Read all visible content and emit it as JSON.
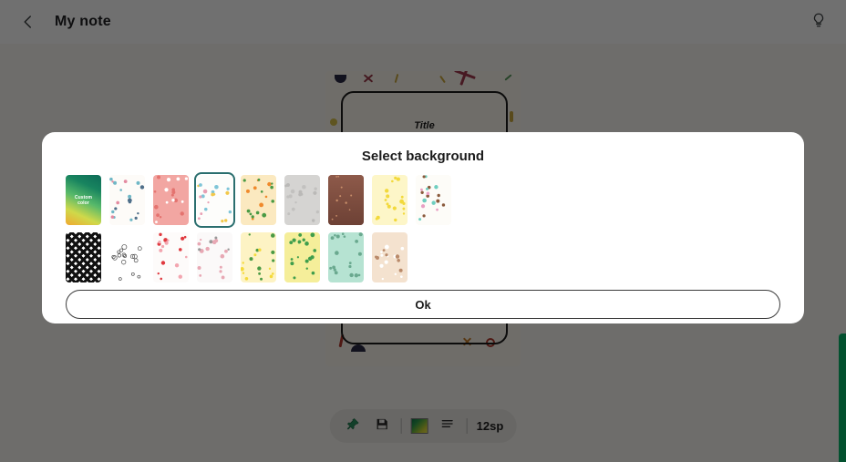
{
  "header": {
    "title": "My note",
    "back_icon": "back-chevron-icon",
    "hint_icon": "lightbulb-icon"
  },
  "note_preview": {
    "title_placeholder": "Title"
  },
  "dialog": {
    "title": "Select background",
    "ok_label": "Ok",
    "selected_index": 3,
    "thumbnails": [
      {
        "name": "custom-color",
        "label": "Custom\ncolor",
        "kind": "gradient",
        "colors": [
          "#f0a830",
          "#cfd94a",
          "#57b96a",
          "#18845f",
          "#0d6b57"
        ]
      },
      {
        "name": "sea-creatures",
        "label": "",
        "kind": "pattern",
        "colors": [
          "#fdfbf8",
          "#4f6f8a",
          "#e38aa0",
          "#6fb7c6"
        ]
      },
      {
        "name": "pink-bunnies",
        "label": "",
        "kind": "pattern",
        "colors": [
          "#f2a6a2",
          "#ffffff",
          "#e4736f"
        ]
      },
      {
        "name": "confetti-stars",
        "label": "",
        "kind": "pattern",
        "colors": [
          "#fdfdfb",
          "#e8a0b4",
          "#7fc5d8",
          "#f2c84b"
        ]
      },
      {
        "name": "oranges",
        "label": "",
        "kind": "pattern",
        "colors": [
          "#fbe9c0",
          "#f08a2c",
          "#4a9a44"
        ]
      },
      {
        "name": "gray-texture",
        "label": "",
        "kind": "pattern",
        "colors": [
          "#d5d4d2",
          "#bebdbb"
        ]
      },
      {
        "name": "brown-gradient",
        "label": "",
        "kind": "pattern",
        "colors": [
          "#8e5a4a",
          "#6d4135"
        ]
      },
      {
        "name": "bananas",
        "label": "",
        "kind": "pattern",
        "colors": [
          "#fdf6c8",
          "#f2d93c"
        ]
      },
      {
        "name": "donuts",
        "label": "",
        "kind": "pattern",
        "colors": [
          "#fdfcf8",
          "#6fcfc0",
          "#e9a0c4",
          "#8a5a3c"
        ]
      },
      {
        "name": "checkered",
        "label": "",
        "kind": "pattern",
        "colors": [
          "#111111",
          "#ffffff"
        ]
      },
      {
        "name": "line-doodles",
        "label": "",
        "kind": "pattern",
        "colors": [
          "#ffffff",
          "#333333"
        ]
      },
      {
        "name": "red-hearts",
        "label": "",
        "kind": "pattern",
        "colors": [
          "#fdfbfa",
          "#e0393f",
          "#f3a6b0"
        ]
      },
      {
        "name": "gray-cats",
        "label": "",
        "kind": "pattern",
        "colors": [
          "#fbf9f9",
          "#9a9a9a",
          "#e8a8b4"
        ]
      },
      {
        "name": "lemons",
        "label": "",
        "kind": "pattern",
        "colors": [
          "#fdf3c4",
          "#f4d93a",
          "#4a9a44"
        ]
      },
      {
        "name": "green-leaves",
        "label": "",
        "kind": "pattern",
        "colors": [
          "#f5ee9a",
          "#3f9e4c"
        ]
      },
      {
        "name": "mint-sprigs",
        "label": "",
        "kind": "pattern",
        "colors": [
          "#b6e3d2",
          "#6aa98f"
        ]
      },
      {
        "name": "tan-flowers",
        "label": "",
        "kind": "pattern",
        "colors": [
          "#f4e2cf",
          "#b98a6a",
          "#ffffff"
        ]
      }
    ]
  },
  "toolbar": {
    "pin_icon": "pin-icon",
    "save_icon": "save-floppy-icon",
    "color_icon": "color-swatch-icon",
    "list_icon": "list-icon",
    "font_size": "12sp"
  },
  "colors": {
    "accent_green": "#07b96b",
    "selection_border": "#2a6e6e",
    "scrim": "rgba(0,0,0,0.56)",
    "dialog_bg": "#ffffff",
    "page_bg": "#fbf9f4"
  }
}
